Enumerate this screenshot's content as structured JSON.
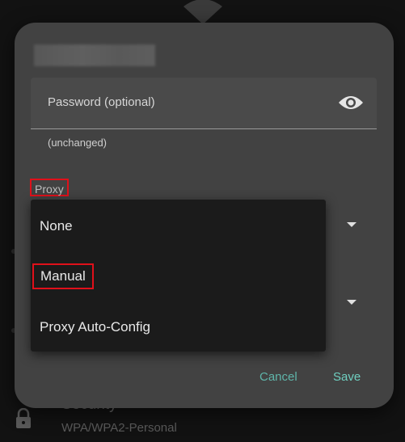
{
  "background": {
    "security_title": "Security",
    "security_subtitle": "WPA/WPA2-Personal"
  },
  "dialog": {
    "password_field": {
      "label": "Password (optional)",
      "helper": "(unchanged)"
    },
    "proxy_label": "Proxy",
    "proxy_menu": {
      "options": [
        "None",
        "Manual",
        "Proxy Auto-Config"
      ]
    },
    "buttons": {
      "cancel": "Cancel",
      "save": "Save"
    }
  },
  "colors": {
    "accent": "#6fcfc0",
    "highlight_box": "#e0101a",
    "dialog_bg": "#424242",
    "menu_bg": "#1b1b1b"
  }
}
